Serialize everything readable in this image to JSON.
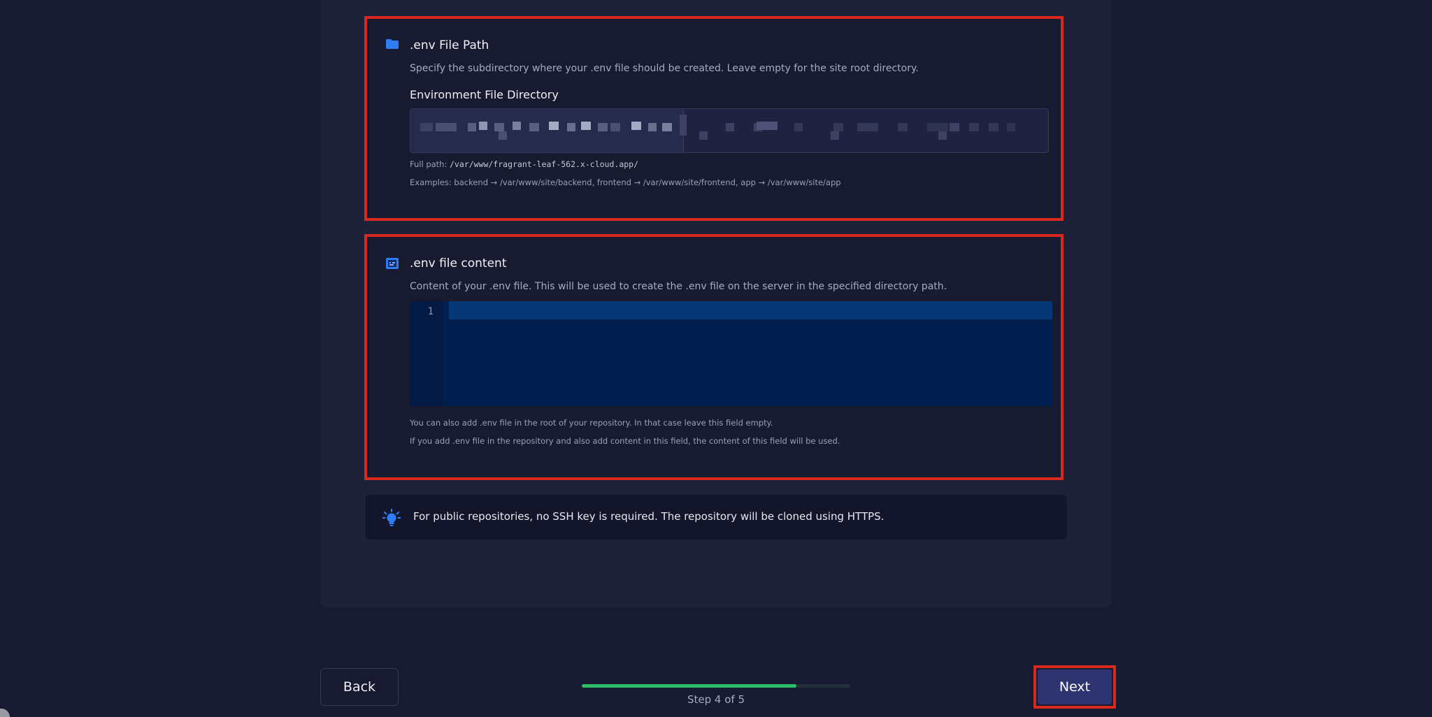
{
  "env_path": {
    "icon": "folder-icon",
    "title": ".env File Path",
    "description": "Specify the subdirectory where your .env file should be created. Leave empty for the site root directory.",
    "field_label": "Environment File Directory",
    "full_path_label": "Full path:",
    "full_path_value": "/var/www/fragrant-leaf-562.x-cloud.app/",
    "examples": "Examples: backend → /var/www/site/backend, frontend → /var/www/site/frontend, app → /var/www/site/app"
  },
  "env_content": {
    "icon": "file-code-icon",
    "title": ".env file content",
    "description": "Content of your .env file. This will be used to create the .env file on the server in the specified directory path.",
    "line_number": "1",
    "hint_1": "You can also add .env file in the root of your repository. In that case leave this field empty.",
    "hint_2": "If you add .env file in the repository and also add content in this field, the content of this field will be used."
  },
  "tip": {
    "icon": "lightbulb-icon",
    "text": "For public repositories, no SSH key is required. The repository will be cloned using HTTPS."
  },
  "footer": {
    "back_label": "Back",
    "next_label": "Next",
    "step_text": "Step 4 of 5",
    "progress_fraction": 0.8
  },
  "colors": {
    "highlight": "#d8291c",
    "progress": "#2fbe6a",
    "accent": "#1f6feb"
  }
}
